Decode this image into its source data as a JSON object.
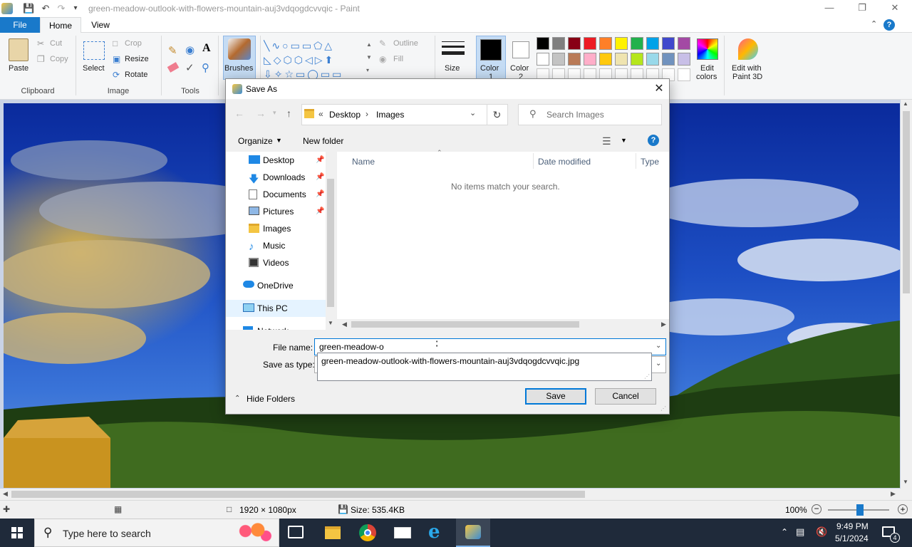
{
  "window": {
    "title": "green-meadow-outlook-with-flowers-mountain-auj3vdqogdcvvqic - Paint"
  },
  "tabs": [
    {
      "label": "File"
    },
    {
      "label": "Home"
    },
    {
      "label": "View"
    }
  ],
  "ribbon": {
    "clipboard": {
      "paste": "Paste",
      "cut": "Cut",
      "copy": "Copy",
      "label": "Clipboard"
    },
    "image": {
      "select": "Select",
      "crop": "Crop",
      "resize": "Resize",
      "rotate": "Rotate",
      "label": "Image"
    },
    "tools": {
      "label": "Tools"
    },
    "brushes": {
      "label": "Brushes"
    },
    "shapes": {
      "outline": "Outline",
      "fill": "Fill"
    },
    "size": {
      "label": "Size"
    },
    "color1": {
      "line1": "Color",
      "line2": "1"
    },
    "color2": {
      "line1": "Color",
      "line2": "2"
    },
    "edit_colors": {
      "line1": "Edit",
      "line2": "colors"
    },
    "paint3d": {
      "line1": "Edit with",
      "line2": "Paint 3D"
    },
    "palette_row1": [
      "#000000",
      "#7f7f7f",
      "#880015",
      "#ed1c24",
      "#ff7f27",
      "#fff200",
      "#22b14c",
      "#00a2e8",
      "#3f48cc",
      "#a349a4"
    ],
    "palette_row2": [
      "#ffffff",
      "#c3c3c3",
      "#b97a57",
      "#ffaec9",
      "#ffc90e",
      "#efe4b0",
      "#b5e61d",
      "#99d9ea",
      "#7092be",
      "#c8bfe7"
    ]
  },
  "dialog": {
    "title": "Save As",
    "breadcrumb": {
      "prefix": "«",
      "root": "Desktop",
      "sep": "›",
      "current": "Images"
    },
    "search_placeholder": "Search Images",
    "organize": "Organize",
    "new_folder": "New folder",
    "nav": [
      {
        "label": "Desktop",
        "pinned": true
      },
      {
        "label": "Downloads",
        "pinned": true
      },
      {
        "label": "Documents",
        "pinned": true
      },
      {
        "label": "Pictures",
        "pinned": true
      },
      {
        "label": "Images",
        "pinned": false
      },
      {
        "label": "Music",
        "pinned": false
      },
      {
        "label": "Videos",
        "pinned": false
      },
      {
        "label": "OneDrive",
        "pinned": false
      },
      {
        "label": "This PC",
        "pinned": false
      },
      {
        "label": "Network",
        "pinned": false
      }
    ],
    "columns": {
      "name": "Name",
      "date": "Date modified",
      "type": "Type"
    },
    "empty_message": "No items match your search.",
    "file_name_label": "File name:",
    "file_name_value": "green-meadow-o",
    "save_type_label": "Save as type:",
    "suggestion": "green-meadow-outlook-with-flowers-mountain-auj3vdqogdcvvqic.jpg",
    "hide_folders": "Hide Folders",
    "save": "Save",
    "cancel": "Cancel"
  },
  "status": {
    "dimensions": "1920 × 1080px",
    "size": "Size: 535.4KB",
    "zoom": "100%"
  },
  "taskbar": {
    "search_placeholder": "Type here to search",
    "time": "9:49 PM",
    "date": "5/1/2024",
    "notifications": "4"
  }
}
